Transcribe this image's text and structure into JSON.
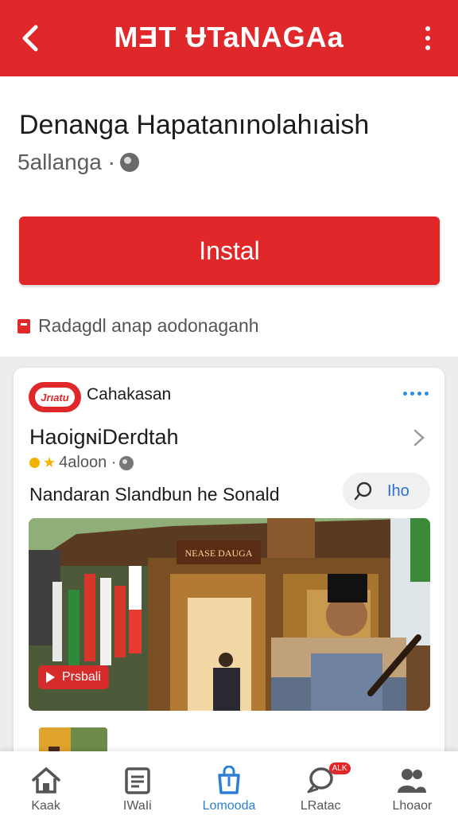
{
  "topbar": {
    "title": "MƎT ɄTaNAGAa"
  },
  "app": {
    "name": "Denaɴga Hapatanınolahıaish",
    "developer": "5allanga ·",
    "install_label": "Instal",
    "notice": "Radagdl anap aodonaganh"
  },
  "card": {
    "logo_text": "Jrıatu",
    "publisher": "Cahakasan",
    "title": "HaoigɴiDerdtah",
    "rating_text": "4aloon ·",
    "description": "Nandaran Slandbun he Sonald",
    "pill_label": "Iho",
    "promo_badge": "Prsbali",
    "promo_sign": "NEASE DAUGA"
  },
  "bottom_nav": [
    {
      "label": "Kaak",
      "icon": "home-icon"
    },
    {
      "label": "IWaIi",
      "icon": "clipboard-icon"
    },
    {
      "label": "Lomooda",
      "icon": "bag-icon",
      "active": true
    },
    {
      "label": "LRatac",
      "icon": "chat-icon",
      "badge": "ALK"
    },
    {
      "label": "Lhoaor",
      "icon": "people-icon"
    }
  ],
  "colors": {
    "accent": "#e0282a",
    "link": "#2d7fd6",
    "star": "#f2b300"
  }
}
